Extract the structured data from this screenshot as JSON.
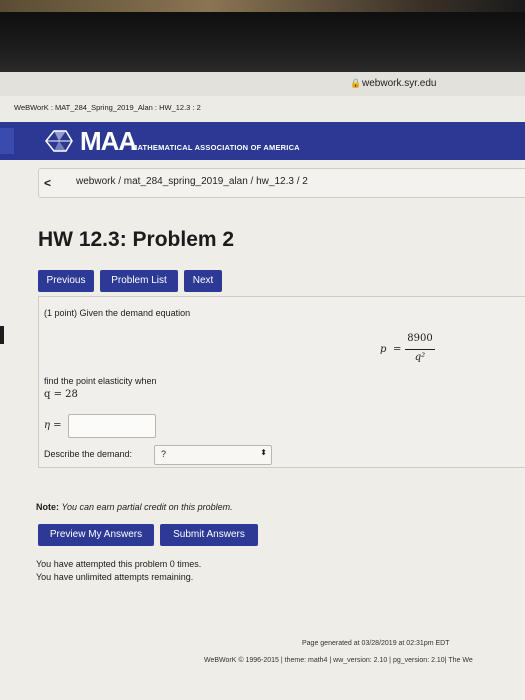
{
  "browser": {
    "url": "webwork.syr.edu",
    "tab_title": "WeBWorK : MAT_284_Spring_2019_Alan : HW_12.3 : 2"
  },
  "header": {
    "logo_text": "MAA",
    "subtitle": "MATHEMATICAL ASSOCIATION OF AMERICA"
  },
  "breadcrumb": {
    "back": "<",
    "path": "webwork / mat_284_spring_2019_alan / hw_12.3 / 2"
  },
  "page": {
    "title": "HW 12.3: Problem 2"
  },
  "nav": {
    "previous": "Previous",
    "problem_list": "Problem List",
    "next": "Next"
  },
  "problem": {
    "intro": "(1 point) Given the demand equation",
    "p_var": "p",
    "equals": "=",
    "numerator": "8900",
    "denominator": "q²",
    "find_text": "find the point elasticity when",
    "q_expr": "q = 28",
    "eta_label": "η =",
    "eta_value": "",
    "describe_label": "Describe the demand:",
    "describe_value": "?",
    "describe_arrow": "⬍"
  },
  "note": {
    "label": "Note:",
    "text": "You can earn partial credit on this problem."
  },
  "actions": {
    "preview": "Preview My Answers",
    "submit": "Submit Answers"
  },
  "attempts": {
    "line1": "You have attempted this problem 0 times.",
    "line2": "You have unlimited attempts remaining."
  },
  "footer": {
    "generated": "Page generated at 03/28/2019 at 02:31pm EDT",
    "copyright": "WeBWorK © 1996-2015 | theme: math4 | ww_version: 2.10 | pg_version: 2.10| The We"
  },
  "colors": {
    "brand_blue": "#2b3994",
    "button_blue": "#2c3a95"
  }
}
